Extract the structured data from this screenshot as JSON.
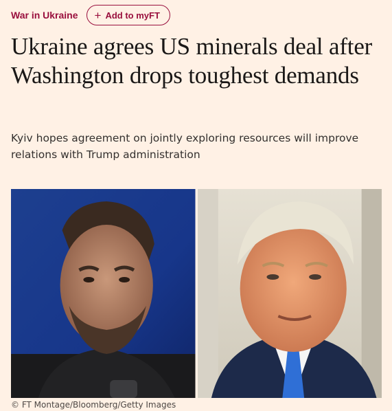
{
  "article": {
    "topic": "War in Ukraine",
    "myft_button": "Add to myFT",
    "headline": "Ukraine agrees US minerals deal after Washington drops toughest demands",
    "standfirst": "Kyiv hopes agreement on jointly exploring resources will improve relations with Trump administration",
    "image_caption": "© FT Montage/Bloomberg/Getty Images"
  },
  "colors": {
    "background": "#fff1e5",
    "accent": "#990f3d",
    "headline": "#1a1817"
  },
  "icons": {
    "add": "plus-icon"
  }
}
